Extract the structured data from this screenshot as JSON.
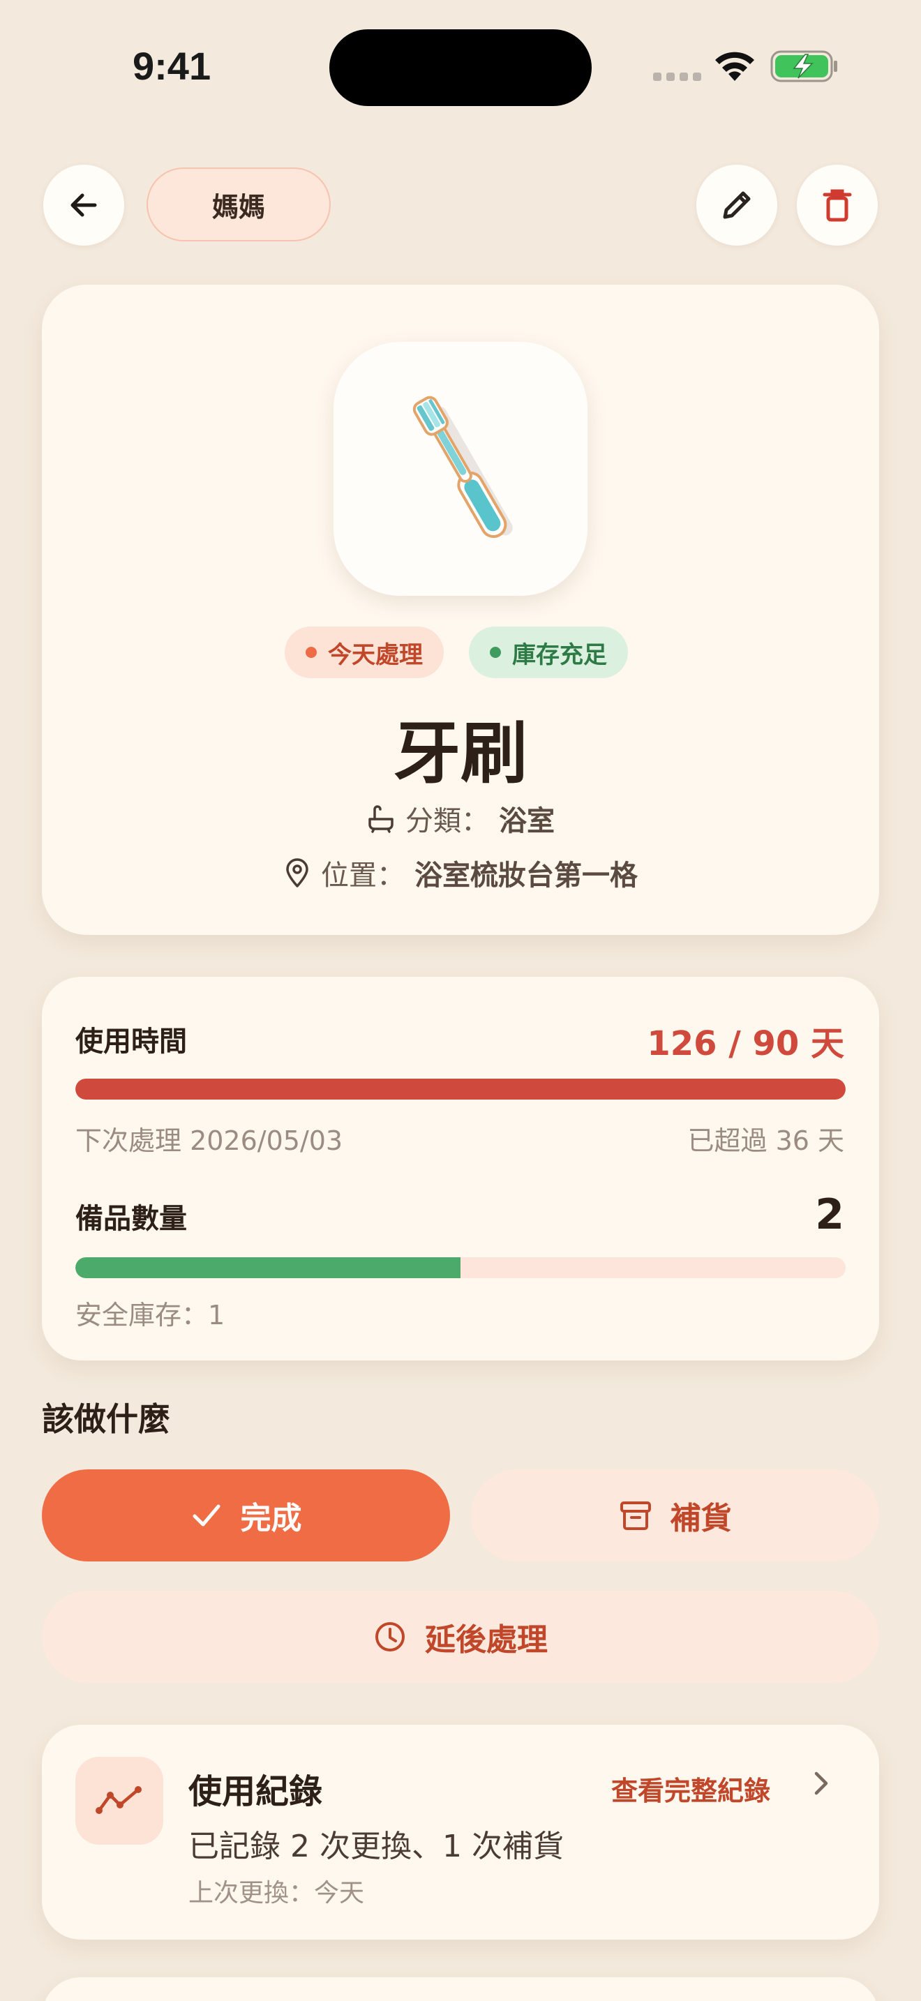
{
  "status_bar": {
    "time": "9:41"
  },
  "header": {
    "owner": "媽媽"
  },
  "item": {
    "image_icon": "toothbrush-image",
    "badges": {
      "due": "今天處理",
      "stock": "庫存充足"
    },
    "name": "牙刷",
    "category_label": "分類：",
    "category_value": "浴室",
    "location_label": "位置：",
    "location_value": "浴室梳妝台第一格"
  },
  "usage": {
    "label": "使用時間",
    "value": "126 / 90 天",
    "progress": 1.0,
    "next_label": "下次處理 2026/05/03",
    "overdue": "已超過 36 天"
  },
  "spares": {
    "label": "備品數量",
    "value": "2",
    "progress": 0.5,
    "safety": "安全庫存：1"
  },
  "actions": {
    "title": "該做什麼",
    "done": "完成",
    "restock": "補貨",
    "postpone": "延後處理"
  },
  "history": {
    "title": "使用紀錄",
    "link": "查看完整紀錄",
    "summary": "已記錄 2 次更換、1 次補貨",
    "last": "上次更換：今天"
  },
  "colors": {
    "accent": "#f06c45",
    "overdue": "#cf4a3c",
    "ok": "#4caa6a",
    "background": "#f3e9dc"
  }
}
